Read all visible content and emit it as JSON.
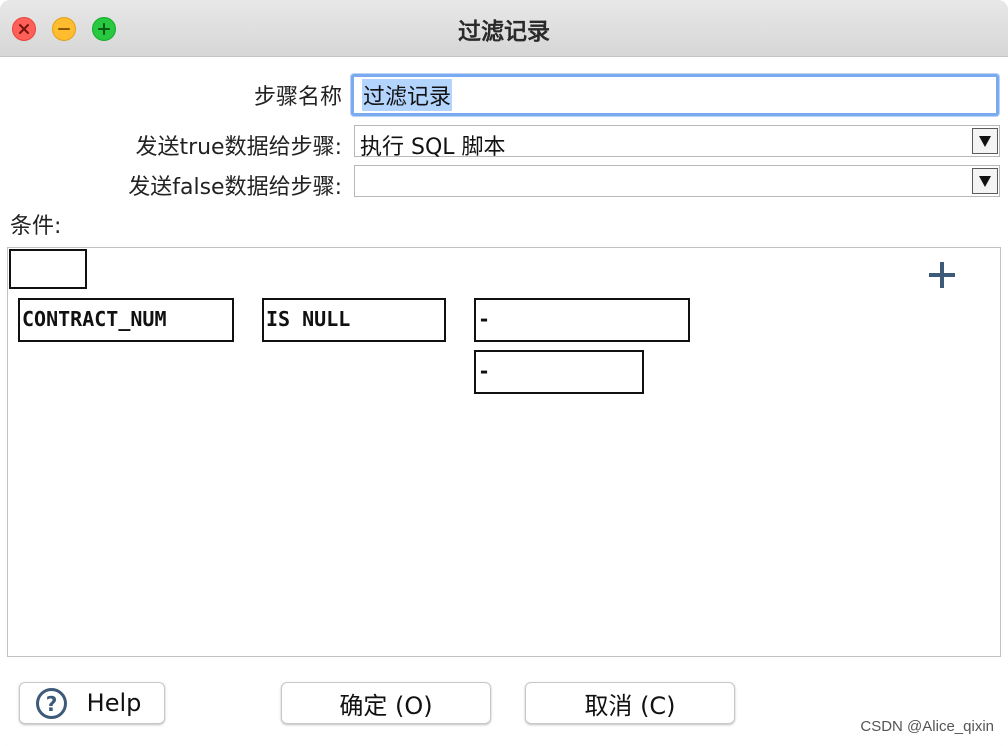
{
  "window": {
    "title": "过滤记录"
  },
  "form": {
    "step_name_label": "步骤名称",
    "step_name_value": "过滤记录",
    "true_step_label": "发送true数据给步骤:",
    "true_step_value": "执行 SQL 脚本",
    "false_step_label": "发送false数据给步骤:",
    "false_step_value": ""
  },
  "conditions": {
    "label": "条件:",
    "field": "CONTRACT_NUM",
    "operator": "IS NULL",
    "value": "-",
    "value2": "-"
  },
  "buttons": {
    "help": "Help",
    "ok": "确定 (O)",
    "cancel": "取消 (C)"
  },
  "watermark": "CSDN @Alice_qixin",
  "colors": {
    "focus_ring": "#7aaaf0",
    "selection": "#b3d4fd",
    "plus_icon": "#3d5a78"
  }
}
